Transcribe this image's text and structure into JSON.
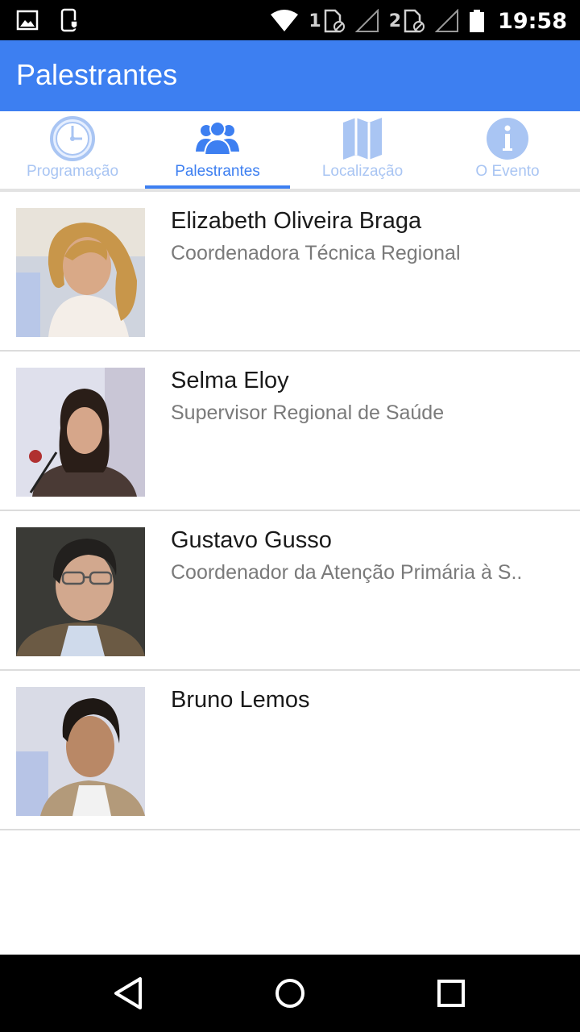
{
  "status_bar": {
    "sim1": "1",
    "sim2": "2",
    "time": "19:58",
    "icons": [
      "image-icon",
      "phone-shield-icon",
      "wifi-icon",
      "sim-card-icon",
      "signal-icon",
      "battery-icon"
    ]
  },
  "app_bar": {
    "title": "Palestrantes",
    "color": "#3d7ff1"
  },
  "tabs": [
    {
      "label": "Programação",
      "icon": "clock-icon",
      "active": false
    },
    {
      "label": "Palestrantes",
      "icon": "people-icon",
      "active": true
    },
    {
      "label": "Localização",
      "icon": "map-icon",
      "active": false
    },
    {
      "label": "O Evento",
      "icon": "info-icon",
      "active": false
    }
  ],
  "speakers": [
    {
      "name": "Elizabeth Oliveira Braga",
      "role": "Coordenadora Técnica Regional"
    },
    {
      "name": "Selma Eloy",
      "role": "Supervisor Regional de Saúde"
    },
    {
      "name": "Gustavo Gusso",
      "role": "Coordenador da Atenção Primária à S.."
    },
    {
      "name": "Bruno Lemos",
      "role": ""
    }
  ],
  "nav_bar": {
    "icons": [
      "back-icon",
      "home-icon",
      "recents-icon"
    ]
  },
  "colors": {
    "accent": "#3d7ff1",
    "tab_inactive": "#a9c5f3",
    "divider": "#dcdcdc"
  }
}
